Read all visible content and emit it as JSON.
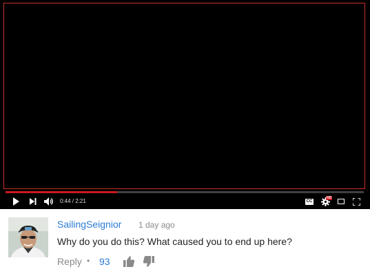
{
  "player": {
    "current_time": "0:44",
    "separator": " / ",
    "duration": "2:21",
    "progress": 0.312,
    "icons": [
      "play-icon",
      "next-icon",
      "volume-icon",
      "captions-icon",
      "settings-icon",
      "miniplayer-icon",
      "fullscreen-icon"
    ],
    "cc_label": "CC",
    "hd_badge": "HD",
    "colors": {
      "progress": "#cc181e",
      "badge": "#cc181e",
      "frame": "#c9312a"
    }
  },
  "comment": {
    "author": "SailingSeignior",
    "timestamp": "1 day ago",
    "text": "Why do you do this? What caused you to end up here?",
    "reply_label": "Reply",
    "separator": "•",
    "like_count": "93",
    "colors": {
      "author": "#2b7bd4",
      "meta": "#8a8a8a"
    }
  }
}
